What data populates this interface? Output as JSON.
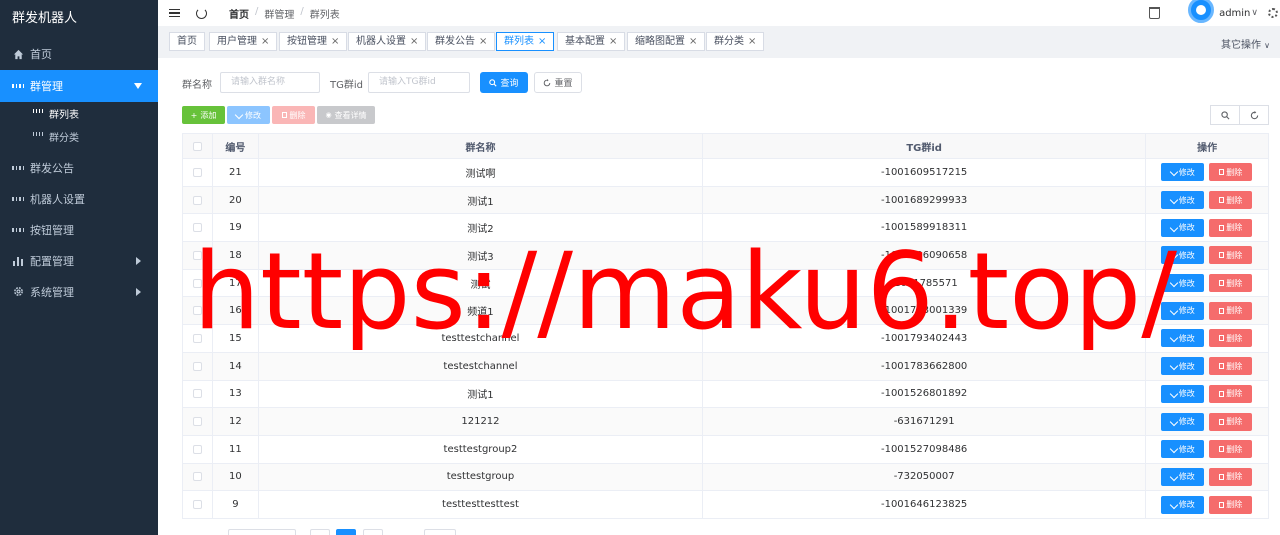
{
  "app": {
    "title": "群发机器人"
  },
  "sidebar": {
    "items": [
      {
        "label": "首页",
        "icon": "home-icon"
      },
      {
        "label": "群管理",
        "icon": "grid-icon",
        "active": true,
        "children": [
          {
            "label": "群列表",
            "current": true
          },
          {
            "label": "群分类"
          }
        ]
      },
      {
        "label": "群发公告",
        "icon": "grid-icon"
      },
      {
        "label": "机器人设置",
        "icon": "grid-icon"
      },
      {
        "label": "按钮管理",
        "icon": "grid-icon"
      },
      {
        "label": "配置管理",
        "icon": "bar-chart-icon"
      },
      {
        "label": "系统管理",
        "icon": "gear-icon"
      }
    ]
  },
  "header": {
    "breadcrumb": [
      "首页",
      "群管理",
      "群列表"
    ],
    "user": "admin"
  },
  "tags": {
    "items": [
      "首页",
      "用户管理",
      "按钮管理",
      "机器人设置",
      "群发公告",
      "群列表",
      "基本配置",
      "缩略图配置",
      "群分类"
    ],
    "active": "群列表",
    "more_label": "其它操作"
  },
  "search": {
    "name_label": "群名称",
    "name_placeholder": "请输入群名称",
    "tgid_label": "TG群id",
    "tgid_placeholder": "请输入TG群id",
    "query_label": "查询",
    "reset_label": "重置"
  },
  "toolbar": {
    "add_label": "添加",
    "edit_label": "修改",
    "delete_label": "删除",
    "view_label": "查看详情"
  },
  "table": {
    "columns": [
      "编号",
      "群名称",
      "TG群id",
      "操作"
    ],
    "edit_label": "修改",
    "delete_label": "删除",
    "rows": [
      {
        "id": "21",
        "name": "测试啊",
        "tgid": "-1001609517215"
      },
      {
        "id": "20",
        "name": "测试1",
        "tgid": "-1001689299933"
      },
      {
        "id": "19",
        "name": "测试2",
        "tgid": "-1001589918311"
      },
      {
        "id": "18",
        "name": "测试3",
        "tgid": "-1001706090658"
      },
      {
        "id": "17",
        "name": "测试",
        "tgid": "-1001785571"
      },
      {
        "id": "16",
        "name": "频道1",
        "tgid": "-1001783001339"
      },
      {
        "id": "15",
        "name": "testtestchannel",
        "tgid": "-1001793402443"
      },
      {
        "id": "14",
        "name": "testestchannel",
        "tgid": "-1001783662800"
      },
      {
        "id": "13",
        "name": "测试1",
        "tgid": "-1001526801892"
      },
      {
        "id": "12",
        "name": "121212",
        "tgid": "-631671291"
      },
      {
        "id": "11",
        "name": "testtestgroup2",
        "tgid": "-1001527098486"
      },
      {
        "id": "10",
        "name": "testtestgroup",
        "tgid": "-732050007"
      },
      {
        "id": "9",
        "name": "testtesttesttest",
        "tgid": "-1001646123825"
      }
    ]
  },
  "watermark": "https://maku6.top/",
  "colors": {
    "primary": "#1890ff",
    "sidebar": "#1f2d3d",
    "success": "#67c23a",
    "danger": "#f56c6c",
    "watermark": "#ff0000"
  }
}
